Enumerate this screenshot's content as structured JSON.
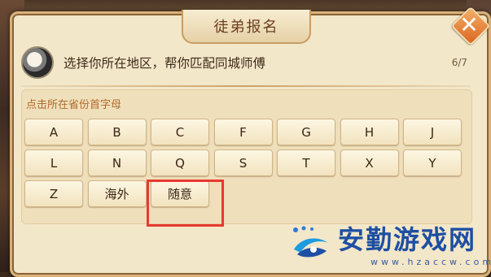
{
  "dialog": {
    "title": "徒弟报名",
    "close_label": "✕",
    "header_text": "选择你所在地区，帮你匹配同城师傅",
    "progress": "6/7",
    "prompt": "点击所在省份首字母"
  },
  "letters": [
    "A",
    "B",
    "C",
    "F",
    "G",
    "H",
    "J",
    "L",
    "N",
    "Q",
    "S",
    "T",
    "X",
    "Y",
    "Z",
    "海外",
    "随意"
  ],
  "highlighted": "随意",
  "watermark": {
    "main": "安勤游戏网",
    "sub": "www.hzaccw.com"
  },
  "colors": {
    "panel": "#f3e7c9",
    "accent_text": "#b26a2e",
    "highlight_border": "#e63a30",
    "watermark": "#1d4fa3"
  }
}
